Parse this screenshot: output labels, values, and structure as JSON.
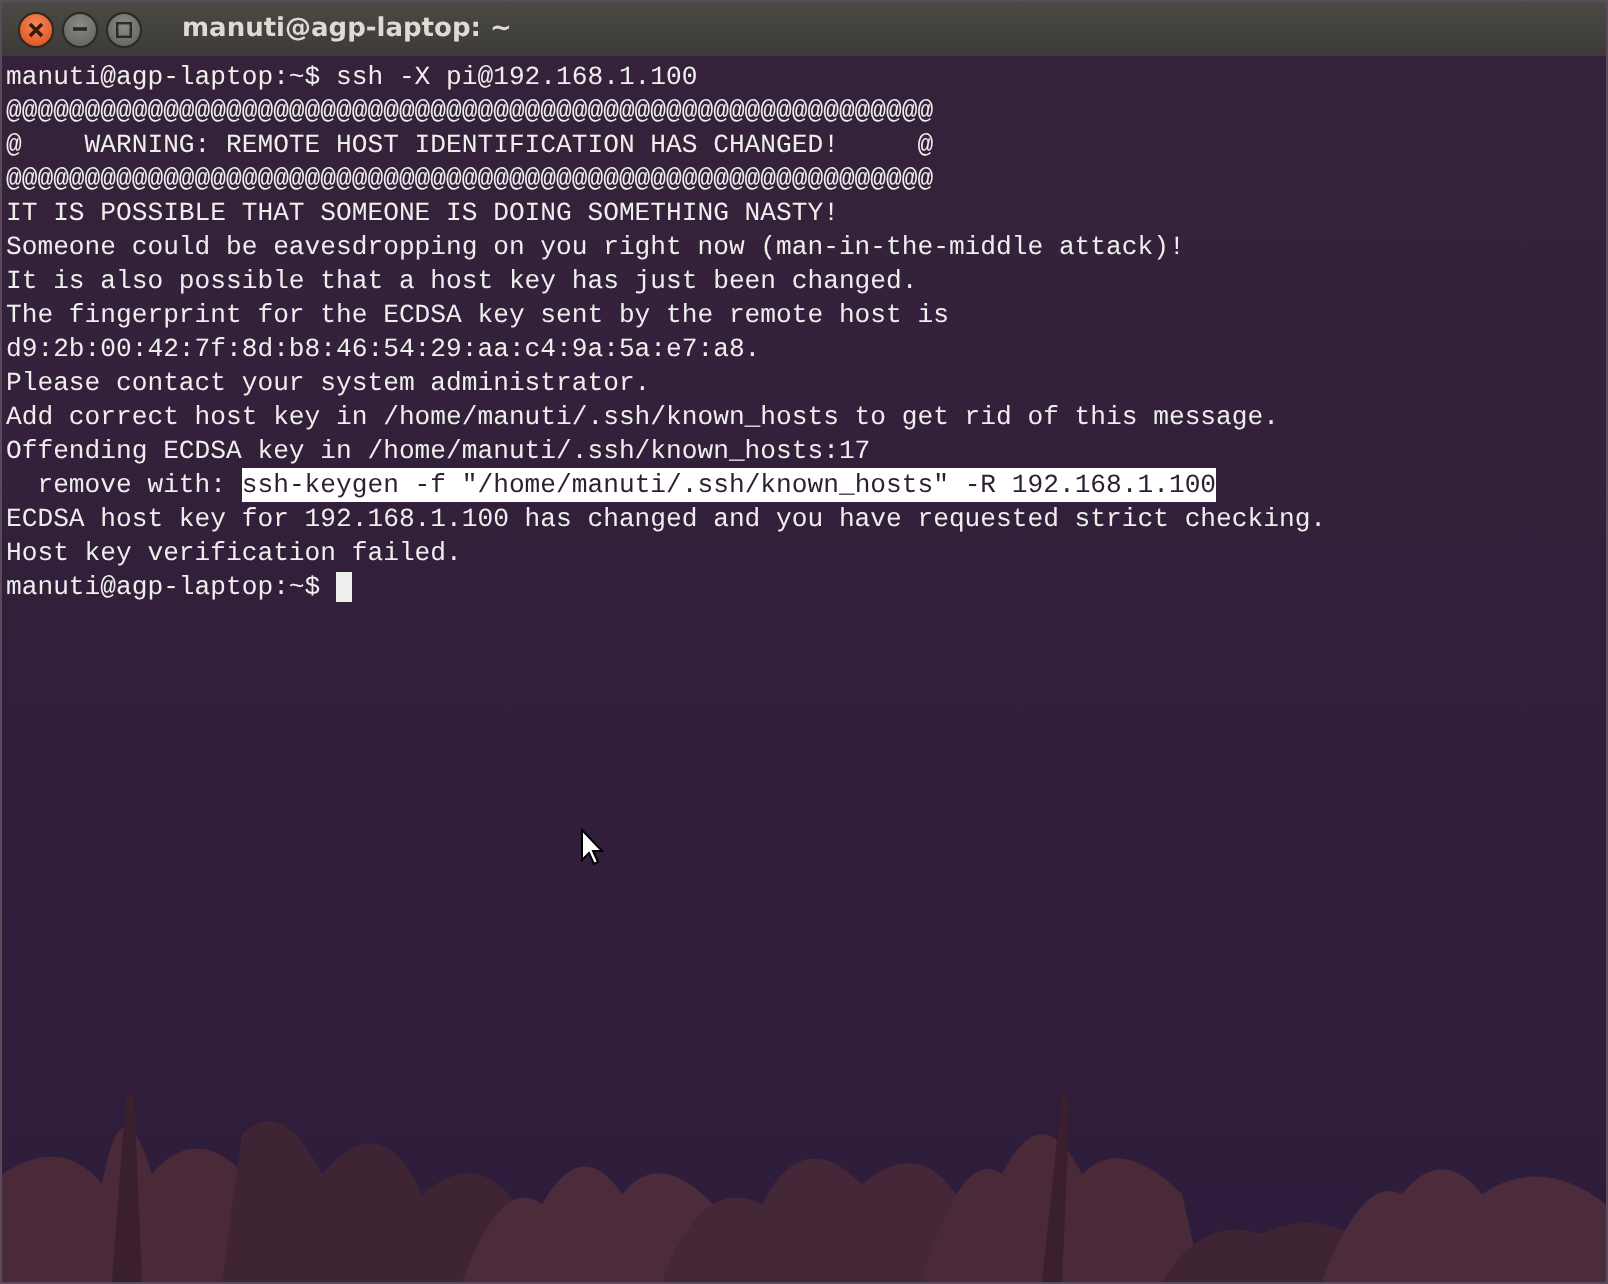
{
  "window": {
    "title": "manuti@agp-laptop: ~"
  },
  "window_buttons": [
    {
      "kind": "close"
    },
    {
      "kind": "minimize"
    },
    {
      "kind": "maximize"
    }
  ],
  "terminal": {
    "lines": [
      {
        "kind": "text",
        "text": "manuti@agp-laptop:~$ ssh -X pi@192.168.1.100"
      },
      {
        "kind": "text",
        "text": "@@@@@@@@@@@@@@@@@@@@@@@@@@@@@@@@@@@@@@@@@@@@@@@@@@@@@@@@@@@"
      },
      {
        "kind": "text",
        "text": "@    WARNING: REMOTE HOST IDENTIFICATION HAS CHANGED!     @"
      },
      {
        "kind": "text",
        "text": "@@@@@@@@@@@@@@@@@@@@@@@@@@@@@@@@@@@@@@@@@@@@@@@@@@@@@@@@@@@"
      },
      {
        "kind": "text",
        "text": "IT IS POSSIBLE THAT SOMEONE IS DOING SOMETHING NASTY!"
      },
      {
        "kind": "text",
        "text": "Someone could be eavesdropping on you right now (man-in-the-middle attack)!"
      },
      {
        "kind": "text",
        "text": "It is also possible that a host key has just been changed."
      },
      {
        "kind": "text",
        "text": "The fingerprint for the ECDSA key sent by the remote host is"
      },
      {
        "kind": "text",
        "text": "d9:2b:00:42:7f:8d:b8:46:54:29:aa:c4:9a:5a:e7:a8."
      },
      {
        "kind": "text",
        "text": "Please contact your system administrator."
      },
      {
        "kind": "text",
        "text": "Add correct host key in /home/manuti/.ssh/known_hosts to get rid of this message."
      },
      {
        "kind": "text",
        "text": "Offending ECDSA key in /home/manuti/.ssh/known_hosts:17"
      },
      {
        "kind": "selection",
        "text": "  remove with: ",
        "selected_text": "ssh-keygen -f \"/home/manuti/.ssh/known_hosts\" -R 192.168.1.100"
      },
      {
        "kind": "text",
        "text": "ECDSA host key for 192.168.1.100 has changed and you have requested strict checking."
      },
      {
        "kind": "text",
        "text": "Host key verification failed."
      },
      {
        "kind": "prompt",
        "text": "manuti@agp-laptop:~$ ",
        "cursor": true
      }
    ]
  }
}
